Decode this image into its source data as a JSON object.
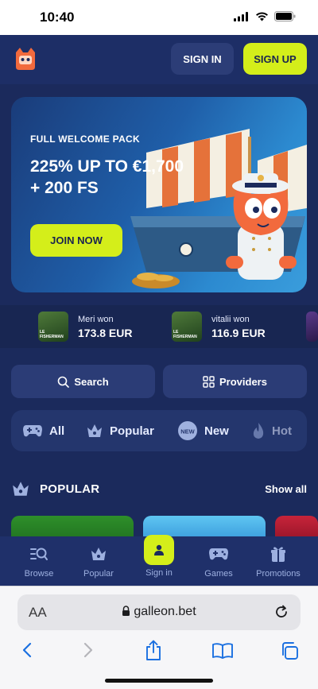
{
  "status_bar": {
    "time": "10:40"
  },
  "header": {
    "signin_label": "SIGN IN",
    "signup_label": "SIGN UP"
  },
  "banner": {
    "subtitle": "FULL WELCOME PACK",
    "title": "225% UP TO €1,700 + 200 FS",
    "cta_label": "JOIN NOW"
  },
  "recent_wins": [
    {
      "name": "Meri won",
      "amount": "173.8 EUR",
      "game": "LE FISHERMAN"
    },
    {
      "name": "vitalii won",
      "amount": "116.9 EUR",
      "game": "LE FISHERMAN"
    }
  ],
  "search": {
    "search_label": "Search",
    "providers_label": "Providers"
  },
  "categories": [
    {
      "label": "All",
      "icon": "gamepad-icon"
    },
    {
      "label": "Popular",
      "icon": "crown-icon"
    },
    {
      "label": "New",
      "icon": "new-badge-icon",
      "badge": "NEW"
    },
    {
      "label": "Hot",
      "icon": "flame-icon"
    }
  ],
  "section": {
    "title": "POPULAR",
    "show_all_label": "Show all"
  },
  "tabbar": {
    "items": [
      {
        "label": "Browse",
        "icon": "browse-icon"
      },
      {
        "label": "Popular",
        "icon": "crown-icon"
      },
      {
        "label": "Sign in",
        "icon": "user-icon"
      },
      {
        "label": "Games",
        "icon": "gamepad-icon"
      },
      {
        "label": "Promotions",
        "icon": "gift-icon"
      }
    ]
  },
  "browser": {
    "text_size_label": "AA",
    "domain": "galleon.bet"
  },
  "colors": {
    "accent": "#d4ee1a",
    "background": "#1b2a5c",
    "panel": "#2b3c76"
  }
}
